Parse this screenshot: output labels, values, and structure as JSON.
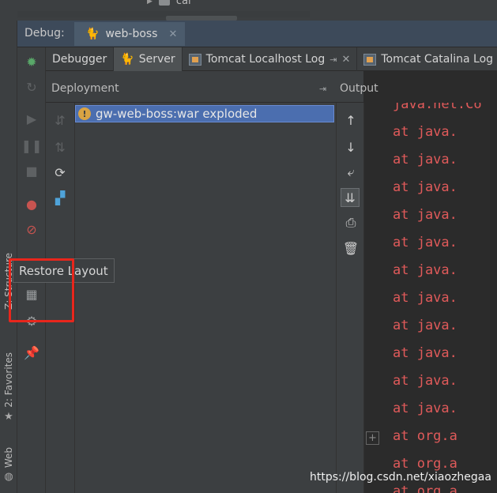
{
  "top_tree": {
    "item_label": "cal"
  },
  "side_tabs": {
    "structure": "Z: Structure",
    "favorites": "2: Favorites",
    "web": "Web"
  },
  "debug_bar": {
    "label": "Debug:",
    "session_tab": "web-boss"
  },
  "tabs": [
    {
      "label": "Debugger"
    },
    {
      "label": "Server"
    },
    {
      "label": "Tomcat Localhost Log"
    },
    {
      "label": "Tomcat Catalina Log"
    }
  ],
  "deployment": {
    "header": "Deployment",
    "items": [
      {
        "label": "gw-web-boss:war exploded",
        "status": "warning"
      }
    ]
  },
  "output": {
    "header": "Output",
    "lines": [
      "java.net.Co",
      "    at java.",
      "    at java.",
      "    at java.",
      "    at java.",
      "    at java.",
      "    at java.",
      "    at java.",
      "    at java.",
      "    at java.",
      "    at java.",
      "    at java.",
      "    at org.a",
      "    at org.a",
      "    at org.a"
    ]
  },
  "tooltip": "Restore Layout",
  "watermark": "https://blog.csdn.net/xiaozhegaa",
  "colors": {
    "highlight_box": "#e8261c",
    "selection": "#4b6eaf",
    "console_error": "#e05a5a",
    "debug_header": "#3d4a5a"
  },
  "icons": {
    "debug_toolbar": [
      "bug-icon",
      "rerun-icon",
      "resume-icon",
      "pause-icon",
      "stop-icon",
      "view-breakpoints-icon",
      "mute-breakpoints-icon",
      "restore-layout-icon",
      "settings-icon",
      "pin-icon"
    ],
    "deploy_actions": [
      "deploy-icon",
      "undeploy-icon",
      "refresh-icon",
      "artifact-icon"
    ],
    "output_actions": [
      "scroll-up-icon",
      "scroll-down-icon",
      "soft-wrap-icon",
      "scroll-to-end-icon",
      "print-icon",
      "clear-icon"
    ]
  }
}
